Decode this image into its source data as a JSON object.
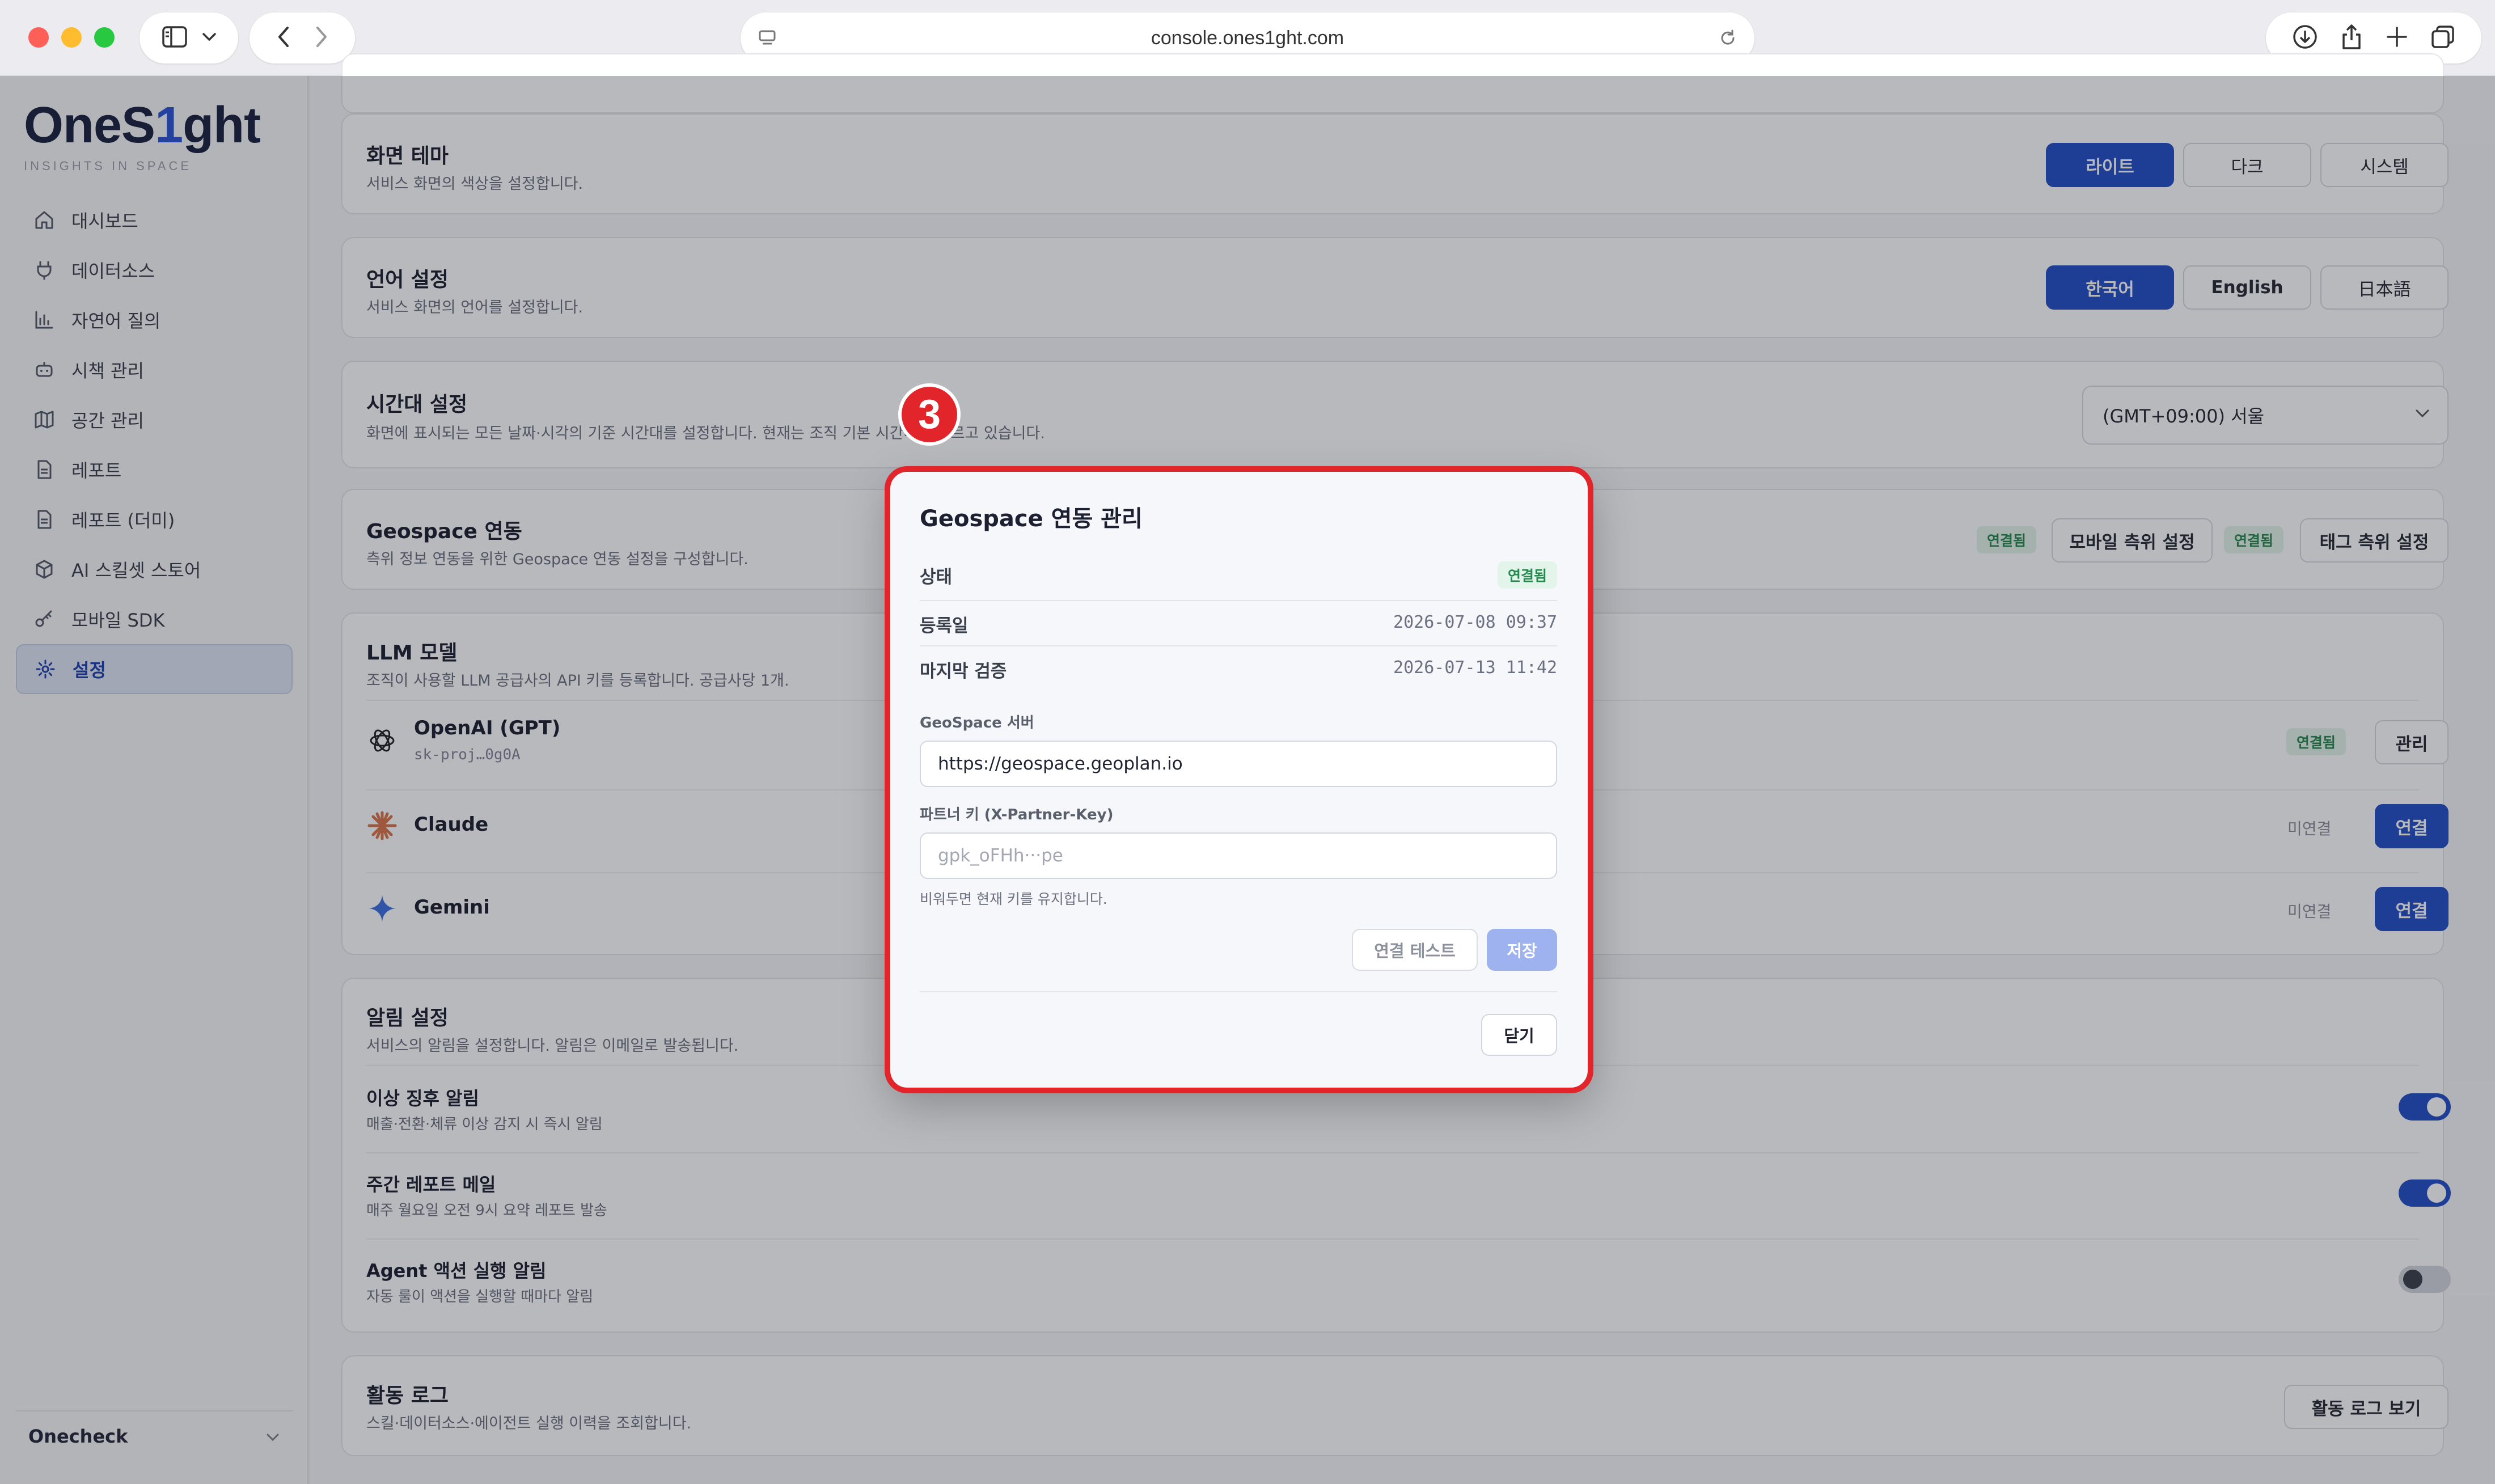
{
  "browser": {
    "url": "console.ones1ght.com"
  },
  "sidebar": {
    "logo": {
      "pre": "OneS",
      "accent": "1",
      "post": "ght"
    },
    "tagline": "INSIGHTS IN SPACE",
    "items": [
      {
        "label": "대시보드",
        "icon": "home-icon"
      },
      {
        "label": "데이터소스",
        "icon": "plug-icon"
      },
      {
        "label": "자연어 질의",
        "icon": "bar-chart-icon"
      },
      {
        "label": "시책 관리",
        "icon": "robot-icon"
      },
      {
        "label": "공간 관리",
        "icon": "map-icon"
      },
      {
        "label": "레포트",
        "icon": "document-icon"
      },
      {
        "label": "레포트 (더미)",
        "icon": "document-icon"
      },
      {
        "label": "AI 스킬셋 스토어",
        "icon": "cube-icon"
      },
      {
        "label": "모바일 SDK",
        "icon": "key-icon"
      },
      {
        "label": "설정",
        "icon": "gear-icon",
        "active": true
      }
    ],
    "workspace": "Onecheck"
  },
  "settings": {
    "theme": {
      "title": "화면 테마",
      "desc": "서비스 화면의 색상을 설정합니다.",
      "options": [
        "라이트",
        "다크",
        "시스템"
      ],
      "selected": "라이트"
    },
    "language": {
      "title": "언어 설정",
      "desc": "서비스 화면의 언어를 설정합니다.",
      "options": [
        "한국어",
        "English",
        "日本語"
      ],
      "selected": "한국어"
    },
    "timezone": {
      "title": "시간대 설정",
      "desc": "화면에 표시되는 모든 날짜·시각의 기준 시간대를 설정합니다. 현재는 조직 기본 시간대를 따르고 있습니다.",
      "value": "(GMT+09:00) 서울"
    },
    "geospace": {
      "title": "Geospace 연동",
      "desc": "측위 정보 연동을 위한 Geospace 연동 설정을 구성합니다.",
      "badge1": "연결됨",
      "button1": "모바일 측위 설정",
      "badge2": "연결됨",
      "button2": "태그 측위 설정"
    },
    "llm": {
      "title": "LLM 모델",
      "desc": "조직이 사용할 LLM 공급사의 API 키를 등록합니다. 공급사당 1개.",
      "providers": [
        {
          "name": "OpenAI (GPT)",
          "key": "sk-proj…0g0A",
          "status": "연결됨",
          "action": "관리"
        },
        {
          "name": "Claude",
          "key": "",
          "status": "미연결",
          "action": "연결"
        },
        {
          "name": "Gemini",
          "key": "",
          "status": "미연결",
          "action": "연결"
        }
      ]
    },
    "alerts": {
      "title": "알림 설정",
      "desc": "서비스의 알림을 설정합니다. 알림은 이메일로 발송됩니다.",
      "items": [
        {
          "title": "이상 징후 알림",
          "desc": "매출·전환·체류 이상 감지 시 즉시 알림",
          "on": true
        },
        {
          "title": "주간 레포트 메일",
          "desc": "매주 월요일 오전 9시 요약 레포트 발송",
          "on": true
        },
        {
          "title": "Agent 액션 실행 알림",
          "desc": "자동 룰이 액션을 실행할 때마다 알림",
          "on": false
        }
      ]
    },
    "activity": {
      "title": "활동 로그",
      "desc": "스킬·데이터소스·에이전트 실행 이력을 조회합니다.",
      "button": "활동 로그 보기"
    }
  },
  "annotation": {
    "step": "3",
    "color": "#e2242b"
  },
  "modal": {
    "title": "Geospace 연동 관리",
    "status_label": "상태",
    "status_value": "연결됨",
    "registered_label": "등록일",
    "registered_value": "2026-07-08 09:37",
    "verified_label": "마지막 검증",
    "verified_value": "2026-07-13 11:42",
    "server_label": "GeoSpace 서버",
    "server_value": "https://geospace.geoplan.io",
    "partner_key_label": "파트너 키 (X-Partner-Key)",
    "partner_key_placeholder": "gpk_oFHh···pe",
    "partner_key_hint": "비워두면 현재 키를 유지합니다.",
    "test_button": "연결 테스트",
    "save_button": "저장",
    "close_button": "닫기"
  },
  "colors": {
    "primary": "#2350c8",
    "success_bg": "#e3f4ea",
    "success_text": "#27884f",
    "highlight": "#e2242b"
  }
}
